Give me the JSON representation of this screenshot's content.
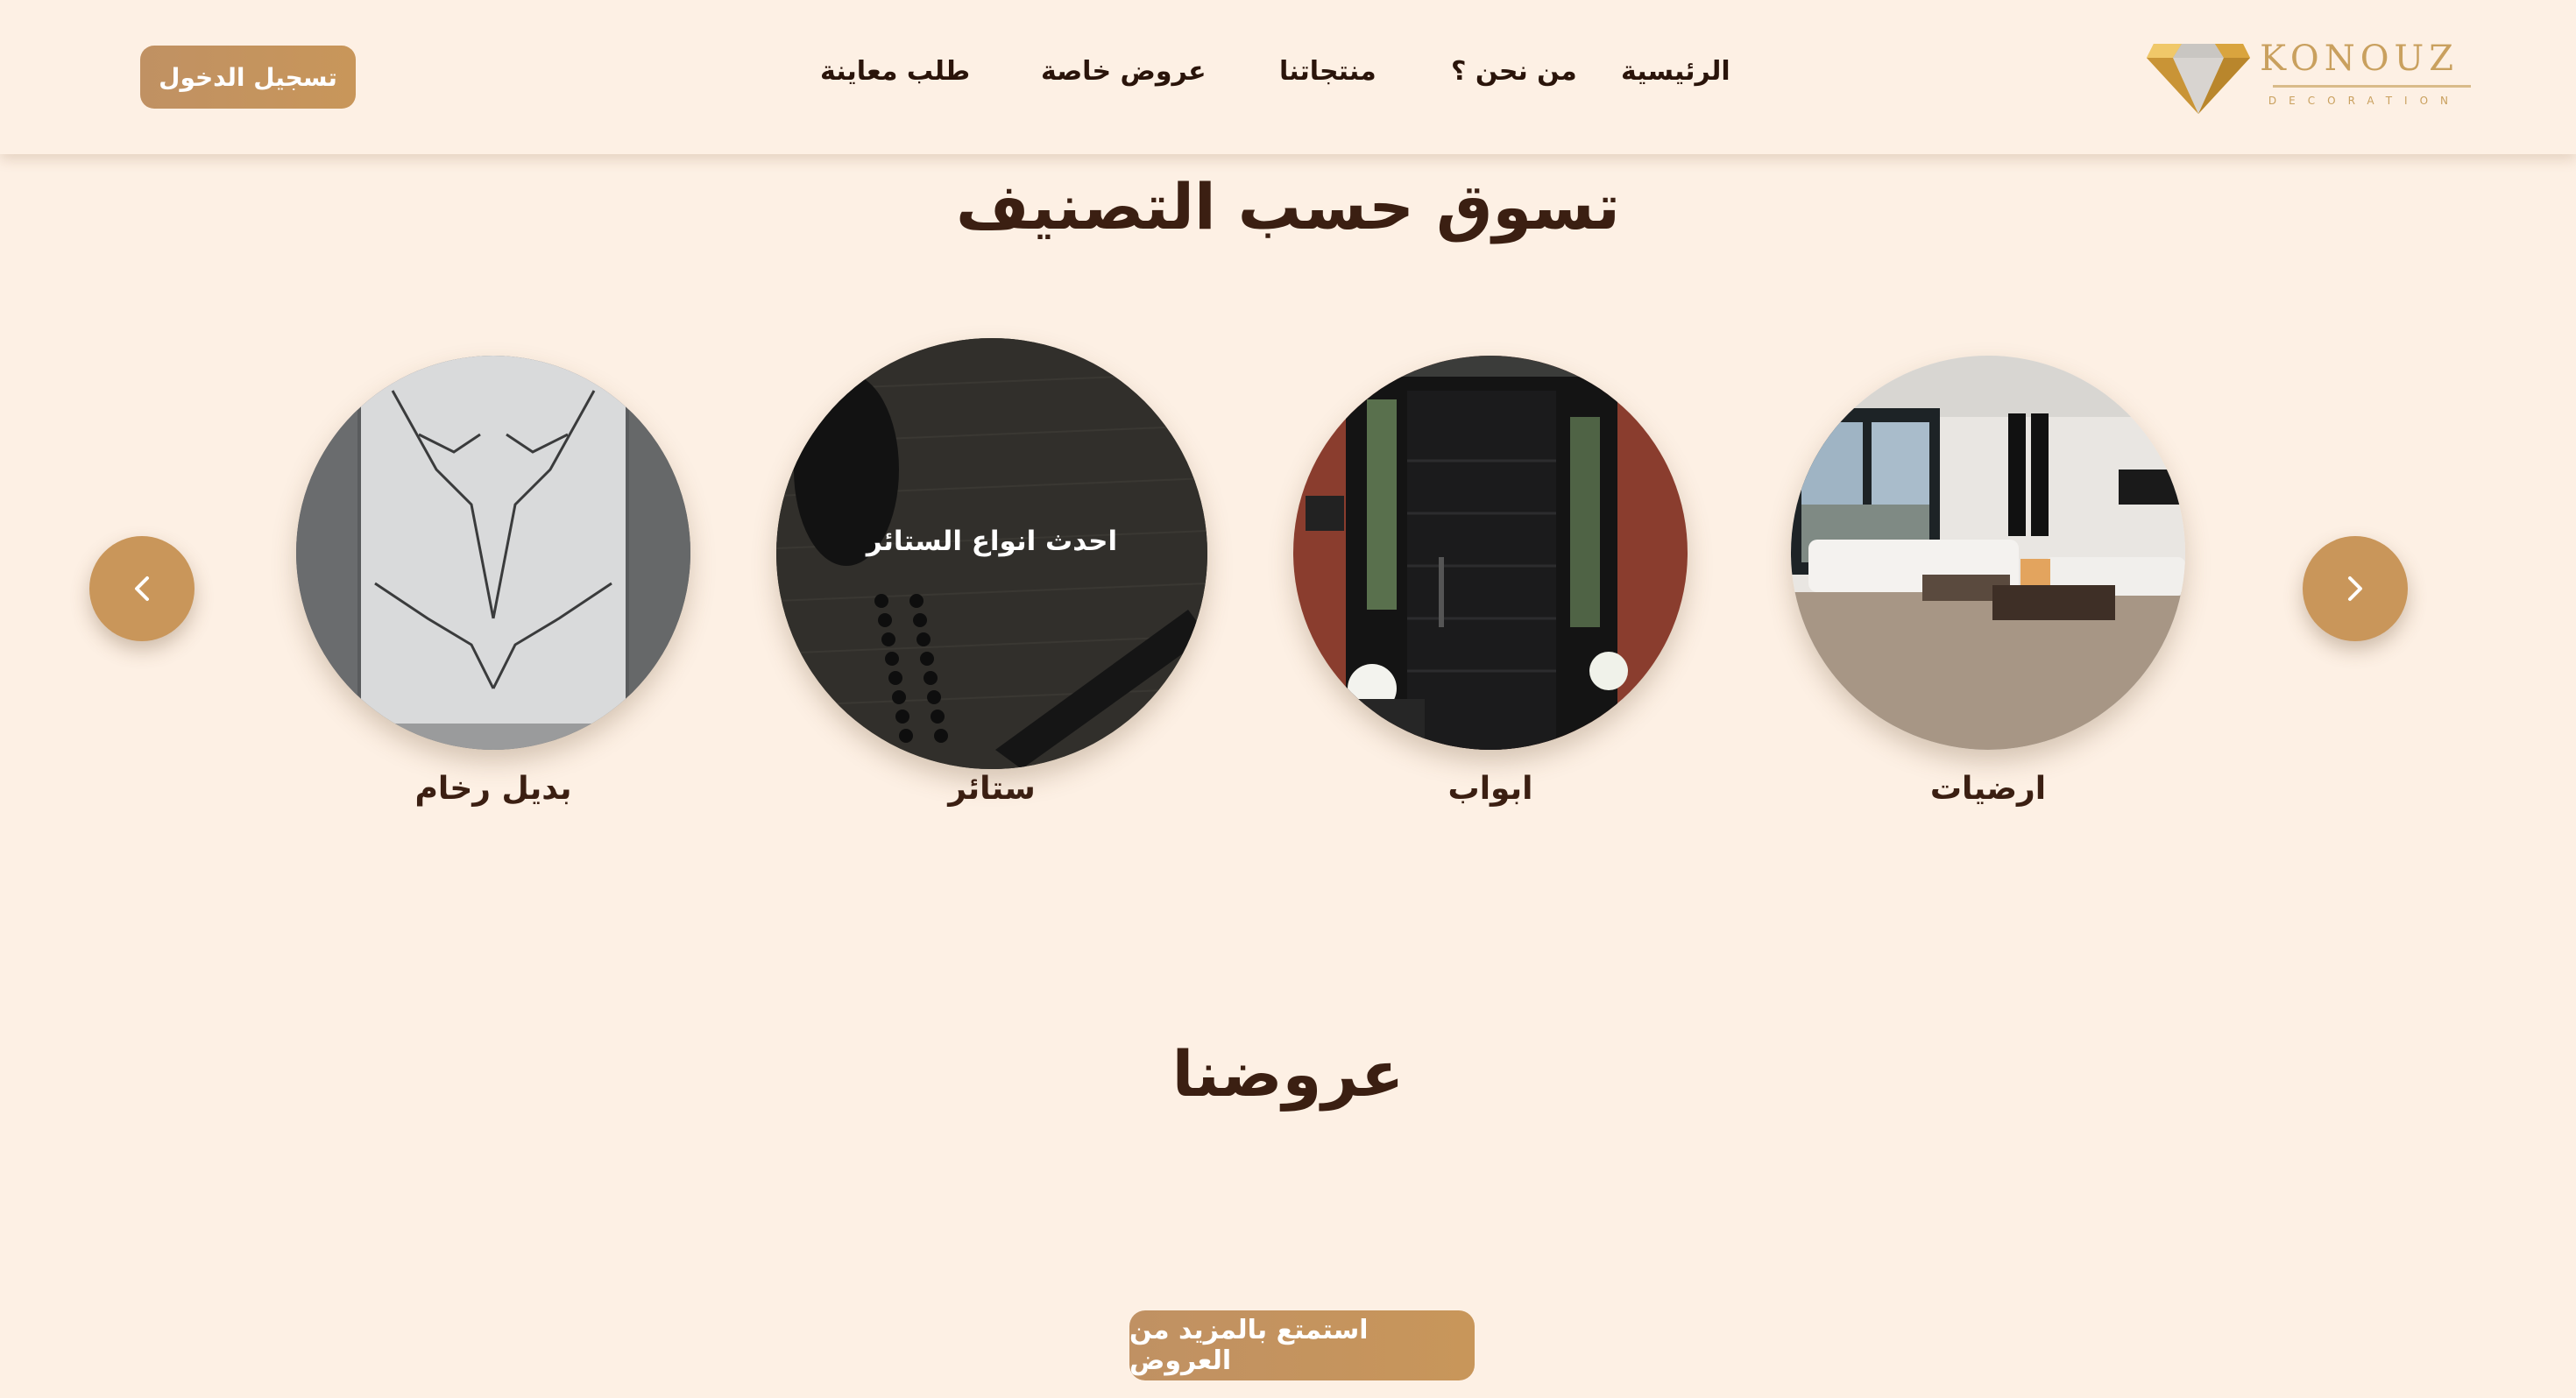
{
  "brand": {
    "name": "KONOUZ",
    "tagline": "DECORATION",
    "logo_icon": "diamond-icon",
    "accent_color": "#c9965a",
    "background_color": "#fdf0e4",
    "text_color": "#3b1f12"
  },
  "nav": {
    "items": [
      {
        "label": "الرئيسية"
      },
      {
        "label": "من نحن ؟"
      },
      {
        "label": "منتجاتنا"
      },
      {
        "label": "عروض خاصة"
      },
      {
        "label": "طلب معاينة"
      }
    ],
    "login_label": "تسجيل الدخول"
  },
  "categories": {
    "title": "تسوق حسب التصنيف",
    "items": [
      {
        "label": "ارضيات"
      },
      {
        "label": "ابواب"
      },
      {
        "label": "ستائر",
        "overlay": "احدث انواع الستائر"
      },
      {
        "label": "بديل رخام"
      }
    ],
    "prev_icon": "chevron-left-icon",
    "next_icon": "chevron-right-icon"
  },
  "offers": {
    "title": "عروضنا",
    "more_label": "استمتع بالمزيد من العروض"
  }
}
